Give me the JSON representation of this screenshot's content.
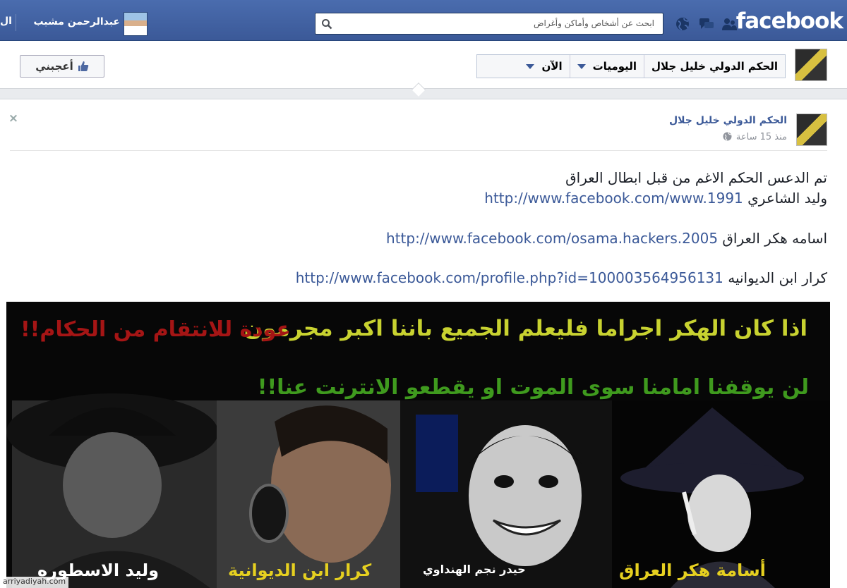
{
  "topbar": {
    "logo": "facebook",
    "search_placeholder": "ابحث عن أشخاص وأماكن وأغراض",
    "username": "عبدالرحمن مشبب",
    "extra": "ال",
    "brand_color": "#3b5998"
  },
  "nav": {
    "page_name": "الحكم الدولي خليل جلال",
    "timeline": "اليوميات",
    "now": "الآن",
    "like": "أعجبني"
  },
  "post": {
    "author": "الحكم الدولي خليل جلال",
    "time": "منذ 15 ساعة",
    "lines": [
      {
        "text": "تم الدعس الحكم الاغم من قبل ابطال العراق",
        "link": ""
      },
      {
        "text": "وليد الشاعري",
        "link": "http://www.facebook.com/www.1991"
      },
      {
        "text": "اسامه هكر العراق",
        "link": "http://www.facebook.com/osama.hackers.2005"
      },
      {
        "text": "كرار ابن الديوانيه",
        "link": "http://www.facebook.com/profile.php?id=100003564956131"
      }
    ]
  },
  "image": {
    "slogan_1": "اذا كان الهكر اجراما فليعلم الجميع باننا اكبر مجرمون",
    "slogan_2": "لن يوقفنا امامنا سوى الموت او يقطعو الانترنت عنا!!",
    "slogan_red": "عودة للانتقام من الحكام!!",
    "captions": [
      "وليد الاسطوره",
      "كرار ابن الديوانية",
      "حيدر نجم الهنداوي",
      "أسامة هكر العراق"
    ]
  },
  "watermark": "arriyadiyah.com"
}
